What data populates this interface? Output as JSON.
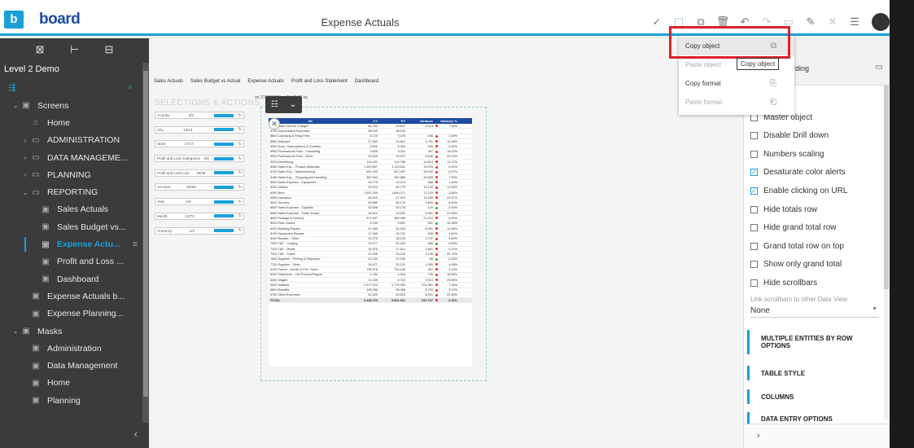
{
  "app": {
    "logo_letter": "b",
    "logo_text": "board",
    "title": "Expense Actuals"
  },
  "toolbar": {
    "icons": [
      "check-icon",
      "select-icon",
      "copy-icon",
      "delete-icon",
      "undo-icon",
      "redo-icon",
      "document-icon",
      "brush-icon",
      "close-icon",
      "menu-icon",
      "avatar"
    ]
  },
  "sidebar": {
    "level": "Level 2 Demo",
    "items": [
      {
        "label": "Screens",
        "indent": 0,
        "chev": "⌄",
        "icon": "▣"
      },
      {
        "label": "Home",
        "indent": 1,
        "chev": "",
        "icon": "⌂"
      },
      {
        "label": "ADMINISTRATION",
        "indent": 1,
        "chev": "›",
        "icon": "▭"
      },
      {
        "label": "DATA MANAGEME...",
        "indent": 1,
        "chev": "›",
        "icon": "▭"
      },
      {
        "label": "PLANNING",
        "indent": 1,
        "chev": "›",
        "icon": "▭"
      },
      {
        "label": "REPORTING",
        "indent": 1,
        "chev": "⌄",
        "icon": "▭"
      },
      {
        "label": "Sales Actuals",
        "indent": 2,
        "chev": "",
        "icon": "▣"
      },
      {
        "label": "Sales Budget vs...",
        "indent": 2,
        "chev": "",
        "icon": "▣"
      },
      {
        "label": "Expense Actu...",
        "indent": 2,
        "chev": "",
        "icon": "▣",
        "active": true
      },
      {
        "label": "Profit and Loss ...",
        "indent": 2,
        "chev": "",
        "icon": "▣"
      },
      {
        "label": "Dashboard",
        "indent": 2,
        "chev": "",
        "icon": "▣"
      },
      {
        "label": "Expense Actuals b...",
        "indent": 1,
        "chev": "",
        "icon": "▣"
      },
      {
        "label": "Expense Planning...",
        "indent": 1,
        "chev": "",
        "icon": "▣"
      },
      {
        "label": "Masks",
        "indent": 0,
        "chev": "⌄",
        "icon": "▣"
      },
      {
        "label": "Administration",
        "indent": 1,
        "chev": "",
        "icon": "▣"
      },
      {
        "label": "Data Management",
        "indent": 1,
        "chev": "",
        "icon": "▣"
      },
      {
        "label": "Home",
        "indent": 1,
        "chev": "",
        "icon": "▣"
      },
      {
        "label": "Planning",
        "indent": 1,
        "chev": "",
        "icon": "▣"
      }
    ]
  },
  "canvas": {
    "tabs": [
      "Sales Actuals",
      "Sales Budget vs Actual",
      "Expense Actuals",
      "Profit and Loss Statement",
      "Dashboard"
    ],
    "selections_title": "SELECTIONS & ACTIONS",
    "last_updated": "on 27/02/2023 at 21:42:26 by",
    "selections": [
      {
        "label": "Country",
        "value": "2/2"
      },
      {
        "label": "City",
        "value": "13/13"
      },
      {
        "label": "Store",
        "value": "17/17"
      },
      {
        "label": "Profit and Loss Categories",
        "value": "3/3"
      },
      {
        "label": "Profit and Loss Line",
        "value": "48/48"
      },
      {
        "label": "Account",
        "value": "53/53"
      },
      {
        "label": "Year",
        "value": "1/6"
      },
      {
        "label": "Month",
        "value": "12/72"
      },
      {
        "label": "Currency",
        "value": "2/2"
      }
    ],
    "table": {
      "headers": [
        "All",
        "CY",
        "PY",
        "Variance",
        "Variance %"
      ],
      "rows": [
        [
          "8700 Bank Service Charges",
          "86.760",
          "93.647",
          "6.113",
          "7.58%",
          "r"
        ],
        [
          "8750 Depreciation Expenses",
          "96.000",
          "96.000",
          "",
          "",
          "n"
        ],
        [
          "8800 Licensing & Filing Fees",
          "8.720",
          "9.476",
          "246",
          "2.59%",
          "r"
        ],
        [
          "8850 Software",
          "27.562",
          "24.821",
          "2.751",
          "11.08%",
          "r"
        ],
        [
          "8900 Dues, Subscriptions & Contribu",
          "9.000",
          "8.465",
          "535",
          "6.32%",
          "r"
        ],
        [
          "8950 Professional Fees - Consulting",
          "3.808",
          "3.311",
          "497",
          "15.03%",
          "r"
        ],
        [
          "9000 Professional Fees - Other",
          "29.420",
          "23.872",
          "5.548",
          "23.24%",
          "r"
        ],
        [
          "9000 Advertising",
          "134.201",
          "119.788",
          "14.513",
          "12.12%",
          "r"
        ],
        [
          "8080 Sales Exp. - Product Materials",
          "1.190.607",
          "1.113.631",
          "76.976",
          "6.91%",
          "r"
        ],
        [
          "8100 Sales Exp. - Manufacturing",
          "661.449",
          "622.407",
          "39.042",
          "6.27%",
          "r"
        ],
        [
          "8180 Sales Exp. - Shipping and Handling",
          "387.544",
          "360.889",
          "26.655",
          "7.39%",
          "r"
        ],
        [
          "8200 Sales Expense - Equipment",
          "39.778",
          "39.210",
          "568",
          "1.45%",
          "r"
        ],
        [
          "8250 Utilities",
          "99.924",
          "89.779",
          "10.145",
          "11.30%",
          "r"
        ],
        [
          "8300 Rent",
          "1.921.200",
          "1.850.071",
          "71.129",
          "3.84%",
          "r"
        ],
        [
          "8350 Insurance",
          "58.920",
          "47.915",
          "11.005",
          "22.97%",
          "r"
        ],
        [
          "8400 Security",
          "59.865",
          "55.175",
          "4.690",
          "8.50%",
          "r"
        ],
        [
          "8500 Sales Expense - Supplies",
          "30.058",
          "30.178",
          "-120",
          "-0.40%",
          "g"
        ],
        [
          "8550 Sales Expense - Trade Shows",
          "28.612",
          "23.531",
          "5.081",
          "21.59%",
          "r"
        ],
        [
          "8600 Postage & Delivery",
          "371.497",
          "350.485",
          "21.012",
          "6.00%",
          "r"
        ],
        [
          "8410 Pest Control",
          "5.100",
          "5.691",
          "-591",
          "-10.38%",
          "g"
        ],
        [
          "8420 Building Repairs",
          "57.495",
          "51.004",
          "6.491",
          "12.68%",
          "r"
        ],
        [
          "8130 Equipment Repairs",
          "17.595",
          "16.761",
          "838",
          "4.81%",
          "r"
        ],
        [
          "8440 Repairs - Other",
          "31.073",
          "28.276",
          "2.797",
          "9.89%",
          "r"
        ],
        [
          "7000 T&E - Lodging",
          "19.177",
          "20.163",
          "-986",
          "-4.89%",
          "g"
        ],
        [
          "7100 T&E - Meals",
          "30.375",
          "27.814",
          "2.561",
          "9.21%",
          "r"
        ],
        [
          "7200 T&E - Travel",
          "24.336",
          "15.230",
          "9.106",
          "59.79%",
          "r"
        ],
        [
          "7600 Supplies - Printing & Reproduc",
          "22.133",
          "22.189",
          "-56",
          "-0.25%",
          "g"
        ],
        [
          "7700 Supplies - Other",
          "34.577",
          "33.222",
          "1.355",
          "4.08%",
          "r"
        ],
        [
          "6100 Franch., Excise & Priv. Taxes",
          "735.076",
          "734.148",
          "927",
          "0.13%",
          "r"
        ],
        [
          "6200 Telephone - Cell Phones/Pagers",
          "4.764",
          "4.018",
          "746",
          "18.56%",
          "r"
        ],
        [
          "6400 Wages",
          "11.335",
          "8.722",
          "2.613",
          "29.96%",
          "r"
        ],
        [
          "6500 Salaries",
          "2.977.024",
          "2.775.063",
          "201.961",
          "7.28%",
          "r"
        ],
        [
          "6600 Benefits",
          "105.268",
          "96.465",
          "8.799",
          "9.12%",
          "r"
        ],
        [
          "6700 Other Expenses",
          "52.429",
          "43.518",
          "8.911",
          "20.48%",
          "r"
        ]
      ],
      "total": [
        "TOTAL",
        "9.348.729",
        "8.801.962",
        "541.767",
        "6.16%",
        "r"
      ]
    }
  },
  "context_menu": {
    "items": [
      {
        "label": "Copy object",
        "enabled": true,
        "highlight": true,
        "icon": "⧉"
      },
      {
        "label": "Paste object",
        "enabled": false,
        "icon": ""
      },
      {
        "label": "Copy format",
        "enabled": true,
        "icon": "⎘"
      },
      {
        "label": "Paste format",
        "enabled": false,
        "icon": "⎗"
      }
    ],
    "tooltip": "Copy object"
  },
  "right_panel": {
    "header_label": "hboarding",
    "checkboxes": [
      {
        "label": "Master object",
        "checked": false
      },
      {
        "label": "Disable Drill down",
        "checked": false
      },
      {
        "label": "Numbers scaling",
        "checked": false
      },
      {
        "label": "Desaturate color alerts",
        "checked": true
      },
      {
        "label": "Enable clicking on URL",
        "checked": true
      },
      {
        "label": "Hide totals row",
        "checked": false
      },
      {
        "label": "Hide grand total row",
        "checked": false
      },
      {
        "label": "Grand total row on top",
        "checked": false
      },
      {
        "label": "Show only grand total",
        "checked": false
      },
      {
        "label": "Hide scrollbars",
        "checked": false
      }
    ],
    "link_label": "Link scrollbars to other Data View",
    "link_value": "None",
    "sections": [
      "MULTIPLE ENTITIES BY ROW OPTIONS",
      "TABLE STYLE",
      "COLUMNS",
      "DATA ENTRY OPTIONS"
    ]
  },
  "colors": {
    "accent": "#1aa0d8",
    "brand": "#1d4aa3",
    "highlight_border": "#d9232a",
    "sidebar_bg": "#3b3b3b"
  }
}
